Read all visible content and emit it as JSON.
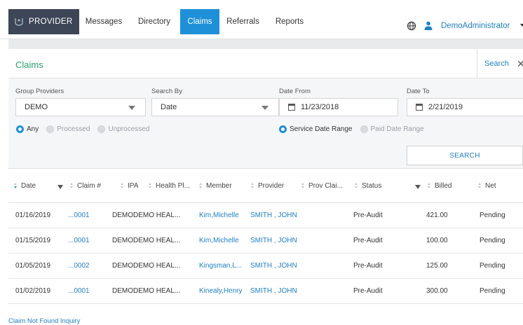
{
  "nav": {
    "brand": "PROVIDER",
    "items": [
      {
        "label": "Messages",
        "active": false
      },
      {
        "label": "Directory",
        "active": false
      },
      {
        "label": "Claims",
        "active": true
      },
      {
        "label": "Referrals",
        "active": false
      },
      {
        "label": "Reports",
        "active": false
      }
    ],
    "user": "DemoAdministrator"
  },
  "claims": {
    "title": "Claims",
    "search_link": "Search",
    "close": "✕"
  },
  "filters": {
    "group_providers": {
      "label": "Group Providers",
      "value": "DEMO"
    },
    "search_by": {
      "label": "Search By",
      "value": "Date"
    },
    "date_from": {
      "label": "Date From",
      "value": "11/23/2018"
    },
    "date_to": {
      "label": "Date To",
      "value": "2/21/2019"
    },
    "status_radios": [
      {
        "label": "Any",
        "selected": true
      },
      {
        "label": "Processed",
        "selected": false
      },
      {
        "label": "Unprocessed",
        "selected": false
      }
    ],
    "date_radios": [
      {
        "label": "Service Date Range",
        "selected": true
      },
      {
        "label": "Paid Date Range",
        "selected": false
      }
    ],
    "search_button": "SEARCH"
  },
  "table": {
    "columns": [
      "Date",
      "Claim #",
      "IPA",
      "Health Pl...",
      "Member",
      "Provider",
      "Prov Clai...",
      "Status",
      "Billed",
      "Net"
    ],
    "rows": [
      {
        "date": "01/16/2019",
        "claim": "...0001",
        "ipa": "DEMO",
        "plan": "DEMO HEAL...",
        "member": "Kim,Michelle",
        "provider": "SMITH , JOHN",
        "status": "Pre-Audit",
        "billed": "421.00",
        "net": "Pending"
      },
      {
        "date": "01/15/2019",
        "claim": "...0001",
        "ipa": "DEMO",
        "plan": "DEMO HEAL...",
        "member": "Kim,Michelle",
        "provider": "SMITH , JOHN",
        "status": "Pre-Audit",
        "billed": "100.00",
        "net": "Pending"
      },
      {
        "date": "01/05/2019",
        "claim": "...0002",
        "ipa": "DEMO",
        "plan": "DEMO HEAL...",
        "member": "Kingsman,L...",
        "provider": "SMITH , JOHN",
        "status": "Pre-Audit",
        "billed": "125.00",
        "net": "Pending"
      },
      {
        "date": "01/02/2019",
        "claim": "...0001",
        "ipa": "DEMO",
        "plan": "DEMO HEAL...",
        "member": "Kinealy,Henry",
        "provider": "SMITH , JOHN",
        "status": "Pre-Audit",
        "billed": "300.00",
        "net": "Pending"
      }
    ]
  },
  "footer": {
    "link": "Claim Not Found Inquiry"
  },
  "colors": {
    "accent": "#1e90d8",
    "brand_bg": "#3c4656",
    "title_green": "#2aa36b",
    "link": "#1e7fc4"
  }
}
